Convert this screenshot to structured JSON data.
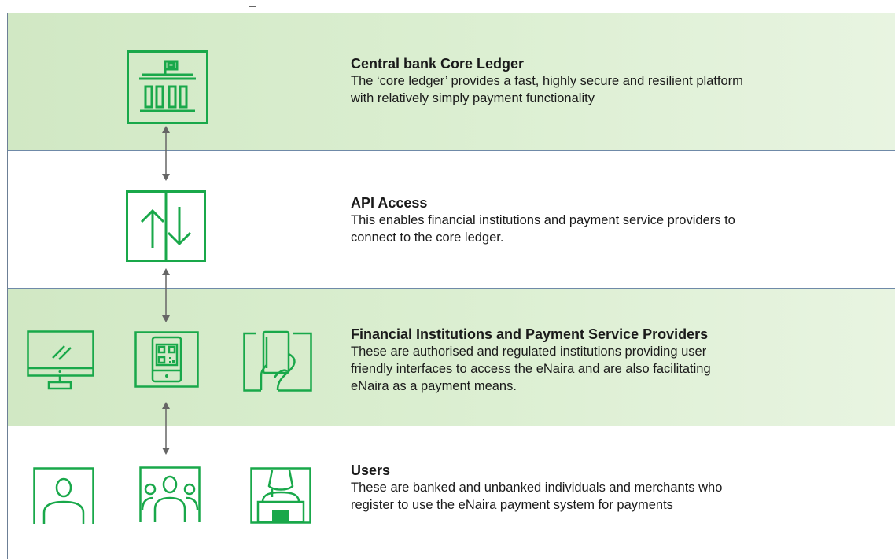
{
  "layers": [
    {
      "title": "Central bank Core Ledger",
      "description_lines": [
        "The ‘core ledger’ provides a fast, highly secure and resilient platform",
        "with relatively simply payment functionality"
      ]
    },
    {
      "title": "API Access",
      "description_lines": [
        "This enables financial institutions and payment service providers to",
        "connect to the core ledger."
      ]
    },
    {
      "title": "Financial Institutions and Payment Service Providers",
      "description_lines": [
        "These are authorised and regulated institutions providing user",
        "friendly interfaces to access the eNaira and are also facilitating",
        "eNaira as a payment means."
      ]
    },
    {
      "title": "Users",
      "description_lines": [
        "These are banked and unbanked individuals and merchants who",
        "register to use the eNaira payment system for payments"
      ]
    }
  ],
  "colors": {
    "icon_green": "#19a84a",
    "band_green": "#d8edcc",
    "divider": "#6f8aa8",
    "arrow": "#666666"
  },
  "icons": [
    "central-bank-icon",
    "api-transfer-icon",
    "computer-monitor-icon",
    "mobile-qr-phone-icon",
    "hand-card-icon",
    "single-user-icon",
    "user-group-icon",
    "merchant-icon"
  ]
}
